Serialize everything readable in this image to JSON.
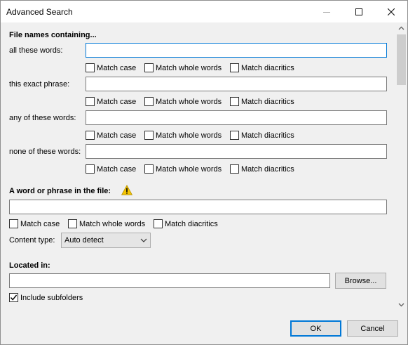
{
  "window": {
    "title": "Advanced Search"
  },
  "file_names": {
    "section_title": "File names containing...",
    "rows": [
      {
        "label": "all these words:",
        "value": ""
      },
      {
        "label": "this exact phrase:",
        "value": ""
      },
      {
        "label": "any of these words:",
        "value": ""
      },
      {
        "label": "none of these words:",
        "value": ""
      }
    ]
  },
  "options": {
    "match_case": "Match case",
    "match_whole_words": "Match whole words",
    "match_diacritics": "Match diacritics"
  },
  "content": {
    "section_title": "A word or phrase in the file:",
    "value": "",
    "content_type_label": "Content type:",
    "content_type_value": "Auto detect"
  },
  "location": {
    "section_title": "Located in:",
    "value": "",
    "browse_label": "Browse...",
    "include_subfolders_label": "Include subfolders",
    "include_subfolders_checked": true
  },
  "footer": {
    "ok_label": "OK",
    "cancel_label": "Cancel"
  },
  "colors": {
    "focus_border": "#0078d7",
    "warning_fill": "#f5c400"
  }
}
